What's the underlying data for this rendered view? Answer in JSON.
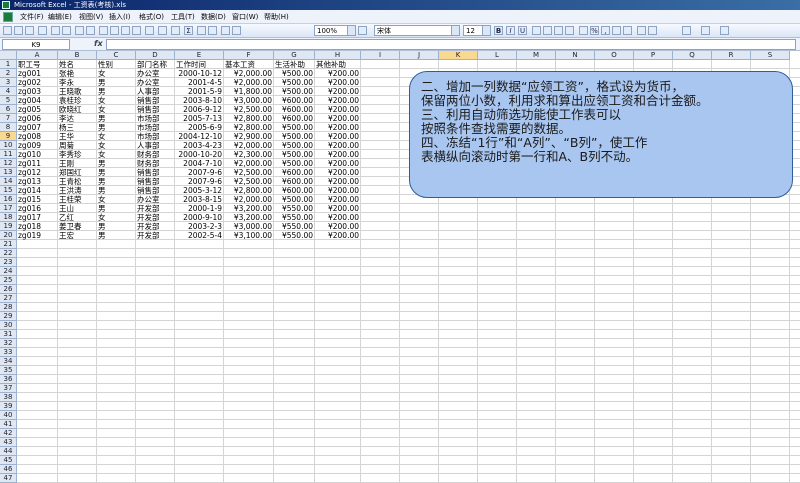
{
  "window": {
    "title": "Microsoft Excel - 工资表(考核).xls"
  },
  "menu": [
    "文件(F)",
    "编辑(E)",
    "视图(V)",
    "插入(I)",
    "格式(O)",
    "工具(T)",
    "数据(D)",
    "窗口(W)",
    "帮助(H)"
  ],
  "toolbar": {
    "zoom": "100%",
    "font_name": "宋体",
    "font_size": "12",
    "bold": "B",
    "italic": "I",
    "underline": "U",
    "percent": "%",
    "comma": ",",
    "sigma": "Σ"
  },
  "formula_bar": {
    "name_box": "K9",
    "fx": "fx",
    "content": ""
  },
  "active_cell": {
    "col": "K",
    "row": 9
  },
  "columns": [
    "A",
    "B",
    "C",
    "D",
    "E",
    "F",
    "G",
    "H",
    "I",
    "J",
    "K",
    "L",
    "M",
    "N",
    "O",
    "P",
    "Q",
    "R",
    "S"
  ],
  "rows": [
    1,
    2,
    3,
    4,
    5,
    6,
    7,
    8,
    9,
    10,
    11,
    12,
    13,
    14,
    15,
    16,
    17,
    18,
    19,
    20,
    21,
    22,
    23,
    24,
    25,
    26,
    27,
    28,
    29,
    30,
    31,
    32,
    33,
    34,
    35,
    36,
    37,
    38,
    39,
    40,
    41,
    42,
    43,
    44,
    45,
    46,
    47
  ],
  "sheet": {
    "headers": [
      "职工号",
      "姓名",
      "性别",
      "部门名称",
      "工作时间",
      "基本工资",
      "生活补助",
      "其他补助"
    ],
    "records": [
      [
        "zg001",
        "张艳",
        "女",
        "办公室",
        "2000-10-12",
        "¥2,000.00",
        "¥500.00",
        "¥200.00"
      ],
      [
        "zg002",
        "李永",
        "男",
        "办公室",
        "2001-4-5",
        "¥2,000.00",
        "¥500.00",
        "¥200.00"
      ],
      [
        "zg003",
        "王晓歌",
        "男",
        "人事部",
        "2001-5-9",
        "¥1,800.00",
        "¥500.00",
        "¥200.00"
      ],
      [
        "zg004",
        "袁桂珍",
        "女",
        "销售部",
        "2003-8-10",
        "¥3,000.00",
        "¥600.00",
        "¥200.00"
      ],
      [
        "zg005",
        "欧晓红",
        "女",
        "销售部",
        "2006-9-12",
        "¥2,500.00",
        "¥600.00",
        "¥200.00"
      ],
      [
        "zg006",
        "李达",
        "男",
        "市场部",
        "2005-7-13",
        "¥2,800.00",
        "¥600.00",
        "¥200.00"
      ],
      [
        "zg007",
        "杨三",
        "男",
        "市场部",
        "2005-6-9",
        "¥2,800.00",
        "¥500.00",
        "¥200.00"
      ],
      [
        "zg008",
        "王华",
        "女",
        "市场部",
        "2004-12-10",
        "¥2,900.00",
        "¥500.00",
        "¥200.00"
      ],
      [
        "zg009",
        "周菊",
        "女",
        "人事部",
        "2003-4-23",
        "¥2,000.00",
        "¥500.00",
        "¥200.00"
      ],
      [
        "zg010",
        "李秀珍",
        "女",
        "财务部",
        "2000-10-20",
        "¥2,300.00",
        "¥500.00",
        "¥200.00"
      ],
      [
        "zg011",
        "王刚",
        "男",
        "财务部",
        "2004-7-10",
        "¥2,000.00",
        "¥500.00",
        "¥200.00"
      ],
      [
        "zg012",
        "郑国红",
        "男",
        "销售部",
        "2007-9-6",
        "¥2,500.00",
        "¥600.00",
        "¥200.00"
      ],
      [
        "zg013",
        "王青松",
        "男",
        "销售部",
        "2007-9-6",
        "¥2,500.00",
        "¥600.00",
        "¥200.00"
      ],
      [
        "zg014",
        "王洪涛",
        "男",
        "销售部",
        "2005-3-12",
        "¥2,800.00",
        "¥600.00",
        "¥200.00"
      ],
      [
        "zg015",
        "王桂荣",
        "女",
        "办公室",
        "2003-8-15",
        "¥2,000.00",
        "¥500.00",
        "¥200.00"
      ],
      [
        "zg016",
        "王山",
        "男",
        "开发部",
        "2000-1-9",
        "¥3,200.00",
        "¥550.00",
        "¥200.00"
      ],
      [
        "zg017",
        "乙红",
        "女",
        "开发部",
        "2000-9-10",
        "¥3,200.00",
        "¥550.00",
        "¥200.00"
      ],
      [
        "zg018",
        "姜卫春",
        "男",
        "开发部",
        "2003-2-3",
        "¥3,000.00",
        "¥550.00",
        "¥200.00"
      ],
      [
        "zg019",
        "王宏",
        "男",
        "开发部",
        "2002-5-4",
        "¥3,100.00",
        "¥550.00",
        "¥200.00"
      ]
    ]
  },
  "callout": {
    "lines": [
      "二、增加一列数据“应领工资”，格式设为货币，",
      "保留两位小数，利用求和算出应领工资和合计金额。",
      "三、利用自动筛选功能使工作表可以",
      "按照条件查找需要的数据。",
      "四、冻结“1行”和“A列”、“B列”，使工作",
      "表横纵向滚动时第一行和A、B列不动。"
    ]
  }
}
